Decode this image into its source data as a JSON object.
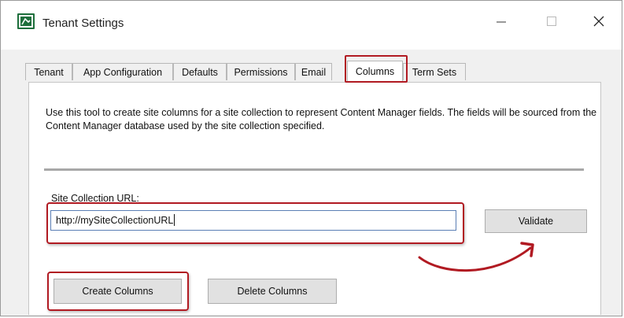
{
  "window": {
    "title": "Tenant Settings",
    "controls": {
      "minimize": "minimize-icon",
      "maximize": "maximize-icon",
      "close": "close-icon"
    }
  },
  "tabs": [
    {
      "label": "Tenant",
      "active": false
    },
    {
      "label": "App Configuration",
      "active": false
    },
    {
      "label": "Defaults",
      "active": false
    },
    {
      "label": "Permissions",
      "active": false
    },
    {
      "label": "Email",
      "active": false
    },
    {
      "label": "Columns",
      "active": true
    },
    {
      "label": "Term Sets",
      "active": false
    }
  ],
  "columns_panel": {
    "description": "Use this tool to create site columns for a site collection to represent Content Manager fields.  The fields will be sourced from the Content Manager database used by the site collection specified.",
    "site_url_label": "Site Collection URL:",
    "site_url_value": "http://mySiteCollectionURL",
    "validate_label": "Validate",
    "create_label": "Create Columns",
    "delete_label": "Delete Columns"
  },
  "colors": {
    "highlight": "#b11a22",
    "app_icon": "#1e6f3c",
    "button_face": "#e1e1e1"
  }
}
